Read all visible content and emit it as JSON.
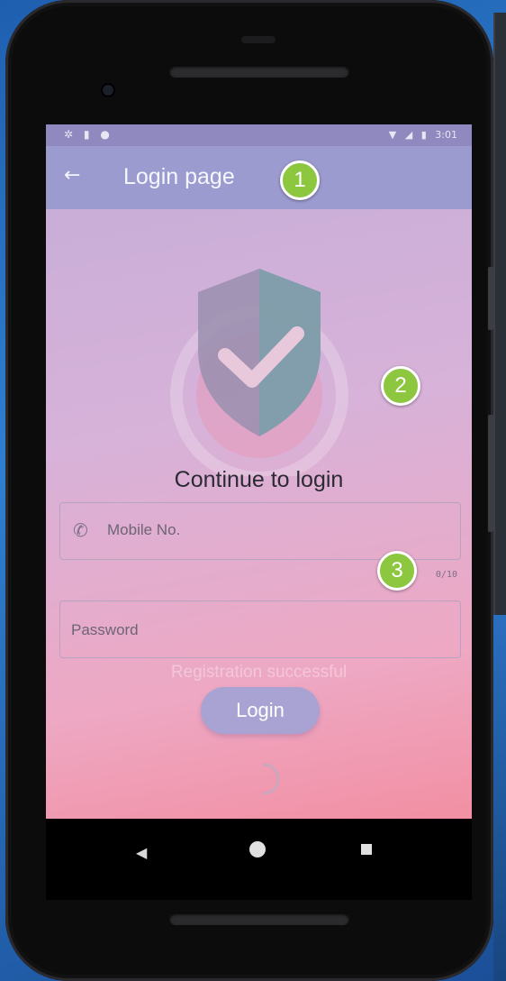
{
  "status_bar": {
    "left_icons": [
      "gear-icon",
      "sd-card-icon",
      "circle-icon"
    ],
    "time": "3:01",
    "right_icons": [
      "wifi-icon",
      "signal-icon",
      "battery-icon"
    ]
  },
  "appbar": {
    "back_icon": "arrow-left-icon",
    "title": "Login page"
  },
  "main": {
    "heading": "Continue to login",
    "mobile_field": {
      "placeholder": "Mobile No.",
      "icon": "phone-icon",
      "counter": "0/10"
    },
    "password_field": {
      "placeholder": "Password"
    },
    "toast": "Registration successful",
    "login_button": "Login"
  },
  "annotations": {
    "markers": [
      "1",
      "2",
      "3"
    ],
    "color": "#8dc63f"
  },
  "nav_bar": {
    "icons": [
      "back-triangle-icon",
      "home-circle-icon",
      "recents-square-icon"
    ]
  },
  "colors": {
    "appbar": "#9c9bd0",
    "button": "#a8a3d3",
    "gradient_end": "#f28fa3"
  }
}
